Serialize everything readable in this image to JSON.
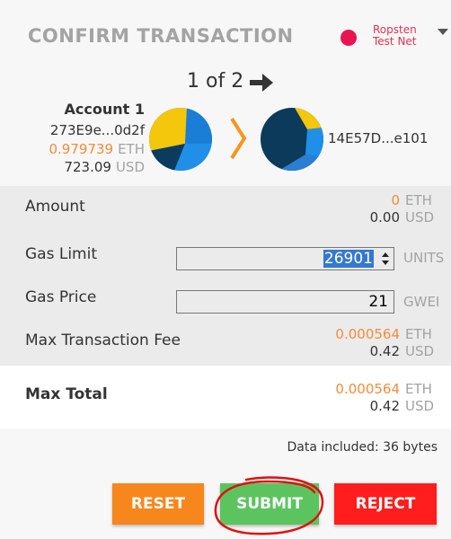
{
  "header": {
    "title": "CONFIRM TRANSACTION",
    "network_line1": "Ropsten",
    "network_line2": "Test Net",
    "network_color": "#e91550"
  },
  "pager": {
    "text": "1 of 2",
    "arrow_icon": "arrow-right-icon"
  },
  "from_account": {
    "name": "Account 1",
    "address": "273E9e...0d2f",
    "balance": "0.979739",
    "balance_unit": "ETH",
    "balance_usd": "723.09",
    "usd_unit": "USD"
  },
  "to_account": {
    "address": "14E57D...e101"
  },
  "details": {
    "amount_label": "Amount",
    "amount_eth": "0",
    "amount_eth_unit": "ETH",
    "amount_usd": "0.00",
    "amount_usd_unit": "USD",
    "gas_limit_label": "Gas Limit",
    "gas_limit_value": "26901",
    "gas_limit_unit": "UNITS",
    "gas_price_label": "Gas Price",
    "gas_price_value": "21",
    "gas_price_unit": "GWEI",
    "max_fee_label": "Max Transaction Fee",
    "max_fee_eth": "0.000564",
    "max_fee_eth_unit": "ETH",
    "max_fee_usd": "0.42",
    "max_fee_usd_unit": "USD"
  },
  "total": {
    "label": "Max Total",
    "eth": "0.000564",
    "eth_unit": "ETH",
    "usd": "0.42",
    "usd_unit": "USD"
  },
  "data_included": "Data included: 36 bytes",
  "buttons": {
    "reset": "RESET",
    "submit": "SUBMIT",
    "reject": "REJECT"
  },
  "colors": {
    "accent_orange": "#f58b3a",
    "reset": "#f7861c",
    "submit": "#5cc45f",
    "reject": "#ff1d1d",
    "annotation": "#e01010"
  }
}
